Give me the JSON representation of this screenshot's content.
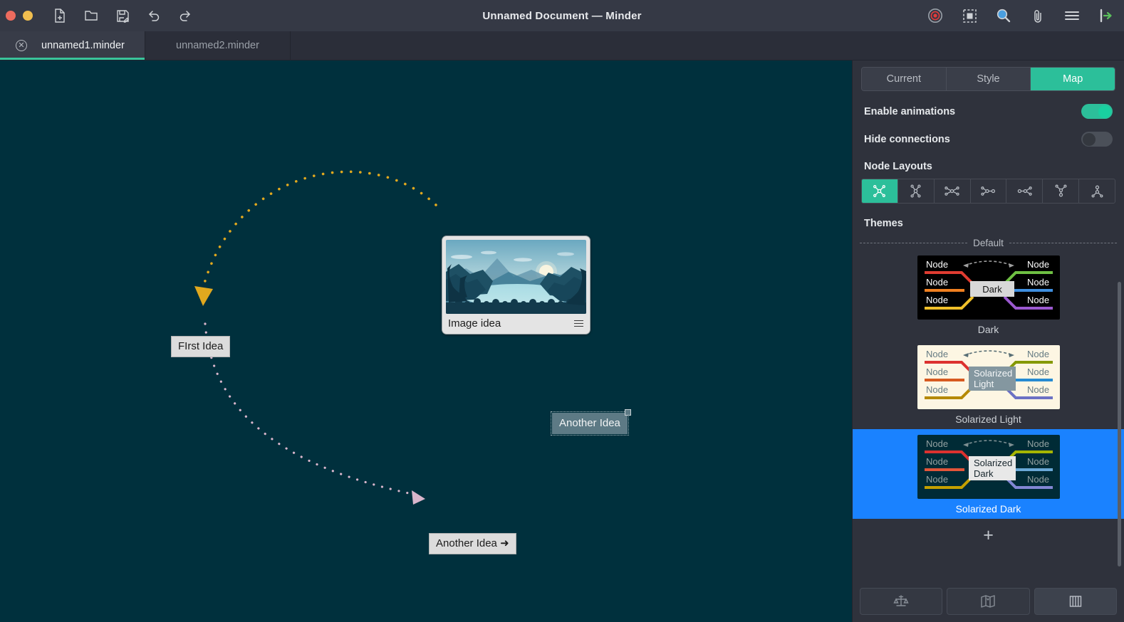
{
  "window": {
    "title": "Unnamed Document — Minder",
    "controls": [
      "close",
      "minimize"
    ],
    "toolbar_left": [
      {
        "name": "new-document-icon",
        "label": "New Document"
      },
      {
        "name": "open-folder-icon",
        "label": "Open"
      },
      {
        "name": "save-icon",
        "label": "Save"
      },
      {
        "name": "undo-icon",
        "label": "Undo"
      },
      {
        "name": "redo-icon",
        "label": "Redo"
      }
    ],
    "toolbar_right": [
      {
        "name": "record-icon",
        "label": "Record"
      },
      {
        "name": "focus-mode-icon",
        "label": "Focus Mode"
      },
      {
        "name": "zoom-search-icon",
        "label": "Zoom"
      },
      {
        "name": "attachment-icon",
        "label": "Attachment"
      },
      {
        "name": "menu-icon",
        "label": "Menu"
      },
      {
        "name": "export-icon",
        "label": "Export"
      }
    ]
  },
  "tabs": [
    {
      "label": "unnamed1.minder",
      "active": true,
      "closable": true
    },
    {
      "label": "unnamed2.minder",
      "active": false,
      "closable": false
    }
  ],
  "canvas": {
    "background_color": "#00303d",
    "nodes": [
      {
        "id": "first-idea",
        "text": "FIrst Idea",
        "type": "text",
        "selected": false
      },
      {
        "id": "image-idea",
        "text": "Image idea",
        "type": "image",
        "selected": false,
        "has_menu_icon": true
      },
      {
        "id": "another-idea-selected",
        "text": "Another Idea",
        "type": "text",
        "selected": true
      },
      {
        "id": "another-idea-arrow",
        "text": "Another Idea ➜",
        "type": "text",
        "selected": false
      }
    ],
    "connections": [
      {
        "from": "image-idea",
        "to": "first-idea",
        "color": "#e0a81e",
        "style": "dotted",
        "arrow": "end"
      },
      {
        "from": "first-idea",
        "to": "another-idea-arrow",
        "color": "#d9b6cc",
        "style": "dotted",
        "arrow": "end"
      }
    ]
  },
  "sidebar": {
    "tabs": [
      {
        "label": "Current",
        "active": false
      },
      {
        "label": "Style",
        "active": false
      },
      {
        "label": "Map",
        "active": true
      }
    ],
    "options": [
      {
        "name": "enable-animations",
        "label": "Enable animations",
        "value": "on"
      },
      {
        "name": "hide-connections",
        "label": "Hide connections",
        "value": "off"
      }
    ],
    "node_layouts_label": "Node Layouts",
    "node_layouts": [
      {
        "name": "layout-manual",
        "active": true
      },
      {
        "name": "layout-vertical",
        "active": false
      },
      {
        "name": "layout-horizontal",
        "active": false
      },
      {
        "name": "layout-to-right",
        "active": false
      },
      {
        "name": "layout-to-left",
        "active": false
      },
      {
        "name": "layout-upwards",
        "active": false
      },
      {
        "name": "layout-downwards",
        "active": false
      }
    ],
    "themes_label": "Themes",
    "themes_group_label": "Default",
    "themes": [
      {
        "name": "Dark",
        "selected": false,
        "preview": {
          "bg": "#000000",
          "root_bg": "#d8d8d8",
          "root_text": "#111111",
          "node_text": "#ffffff",
          "node_label": "Node",
          "branch_colors": [
            "#e03c31",
            "#f08020",
            "#f0c02a",
            "#6fc043",
            "#3f8fe0",
            "#9b59d0"
          ],
          "connector": "#a0a0a0"
        }
      },
      {
        "name": "Solarized Light",
        "selected": false,
        "preview": {
          "bg": "#fdf6e3",
          "root_bg": "#8497a0",
          "root_text": "#f4f6f7",
          "node_text": "#657b83",
          "node_label": "Node",
          "branch_colors": [
            "#dc322f",
            "#d75a20",
            "#b58900",
            "#859900",
            "#268bd2",
            "#6c71c4"
          ],
          "connector": "#586e75"
        }
      },
      {
        "name": "Solarized Dark",
        "selected": true,
        "preview": {
          "bg": "#002b36",
          "root_bg": "#e8e8e8",
          "root_text": "#16242b",
          "node_text": "#93a1a1",
          "node_label": "Node",
          "branch_colors": [
            "#dc322f",
            "#e2553a",
            "#c4a000",
            "#a5b500",
            "#6aa9d8",
            "#8287d4"
          ],
          "connector": "#7d8f92"
        }
      }
    ],
    "add_theme_label": "+",
    "bottom_buttons": [
      {
        "name": "balance-tree-button",
        "active": false
      },
      {
        "name": "fold-map-button",
        "active": false
      },
      {
        "name": "sidebar-columns-button",
        "active": true
      }
    ]
  },
  "colors": {
    "accent": "#2cbf9a",
    "selection_blue": "#1a82ff",
    "chrome": "#353945",
    "panel": "#2f323c",
    "canvas": "#00303d"
  }
}
